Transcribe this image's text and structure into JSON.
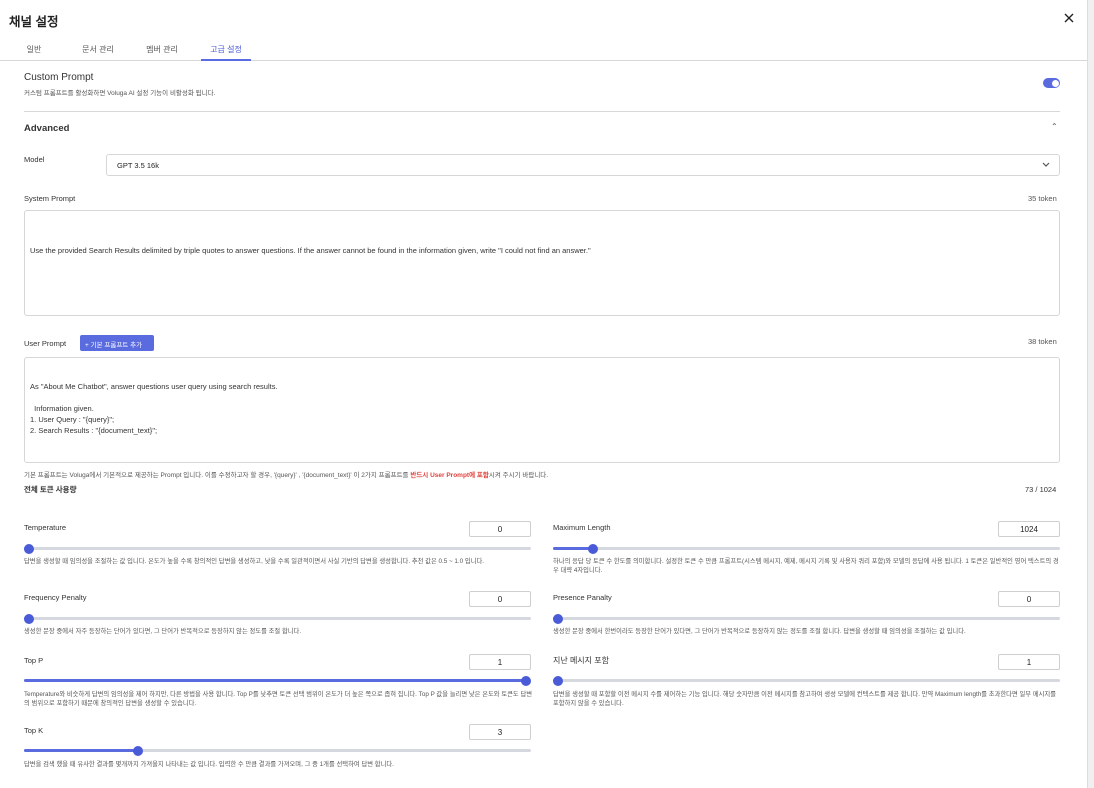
{
  "dialog": {
    "title": "채널 설정"
  },
  "tabs": [
    {
      "label": "일반"
    },
    {
      "label": "문서 관리"
    },
    {
      "label": "멤버 관리"
    },
    {
      "label": "고급 설정"
    }
  ],
  "custom_prompt": {
    "title": "Custom Prompt",
    "description": "커스텀 프롬프트를 활성화하면 Voluga AI 설정 기능이 비활성화 됩니다.",
    "enabled": true
  },
  "advanced": {
    "title": "Advanced",
    "model_label": "Model",
    "model_value": "GPT 3.5 16k",
    "system_prompt": {
      "label": "System Prompt",
      "token_count": "35 token",
      "text": "Use the provided Search Results delimited by triple quotes to answer questions. If the answer cannot be found in the information given, write \"I could not find an answer.\""
    },
    "user_prompt": {
      "label": "User Prompt",
      "add_button": "+ 기본 프롬프트 추가",
      "token_count": "38 token",
      "text": "\nAs \"About Me Chatbot\", answer questions user query using search results.\n\n  Information given.\n1. User Query : \"{query}\";\n2. Search Results : \"{document_text}\";"
    },
    "notice_prefix": "기본 프롬프트는 Voluga에서 기본적으로 제공하는 Prompt 입니다. 이를 수정하고자 할 경우, '{query}' , '{document_text}' 이 2가지 프롬프트를 ",
    "notice_emphasis": "반드시 User Prompt에 포함",
    "notice_suffix": "시켜 주시기 바랍니다.",
    "total_label": "전체 토큰 사용량",
    "total_value": "73 / 1024"
  },
  "params": {
    "temperature": {
      "label": "Temperature",
      "value": "0",
      "level": 0.0,
      "desc": "답변을 생성할 때 임의성을 조절하는 값 입니다. 온도가 높을 수록 창의적인 답변을 생성하고, 낮을 수록 일관적이면서 사실 기반의 답변을 생성합니다. 추천 값은 0.5 ~ 1.0 입니다."
    },
    "max_length": {
      "label": "Maximum Length",
      "value": "1024",
      "level": 0.07,
      "desc": "하나의 응답 당 토큰 수 한도를 의미합니다. 설정한 토큰 수 만큼 프롬프트(시스템 메시지, 예제, 메시지 기록 및 사용자 쿼리 포함)와 모델의 응답에 사용 됩니다. 1 토큰은 일반적인 영어 텍스트의 경우 대략 4자입니다."
    },
    "frequency_penalty": {
      "label": "Frequency Penalty",
      "value": "0",
      "level": 0.0,
      "desc": "생성한 문장 중에서 자주 등장하는 단어가 있다면, 그 단어가 반복적으로 등장하지 않는 정도를 조절 합니다."
    },
    "presence_penalty": {
      "label": "Presence Panalty",
      "value": "0",
      "level": 0.0,
      "desc": "생성한 문장 중에서 한번이라도 등장한 단어가 있다면, 그 단어가 반복적으로 등장하지 않는 정도를 조절 합니다. 답변을 생성할 때 임의성을 조절하는 값 입니다."
    },
    "top_p": {
      "label": "Top P",
      "value": "1",
      "level": 1.0,
      "desc": "Temperature와 비슷하게 답변의 임의성을 제어 하지만, 다른 방법을 사용 합니다. Top P를 낮추면 토큰 선택 범위이 온도가 더 높은 쪽으로 좁혀 집니다. Top P 값을 늘리면 낮은 온도와 토큰도 답변의 범위으로 포함하기 때문에 창의적인 답변을 생성할 수 있습니다."
    },
    "past_messages": {
      "label": "지난 메시지 포함",
      "value": "1",
      "level": 0.0,
      "desc": "답변을 생성할 때 포함할 이전 메시지 수를 제어하는 기능 입니다. 해당 숫자만큼 이전 메시지를 참고하여 생성 모델에 컨텍스트를 제공 합니다. 만약 Maximum length를 초과한다면 일부 메시지를 포함하지 않을 수 있습니다."
    },
    "top_k": {
      "label": "Top K",
      "value": "3",
      "level": 0.22,
      "desc": "답변을 검색 했을 때 유사한 결과를 몇개까지 가져올지 나타내는 값 입니다. 입력한 수 만큼 결과를 가져오며, 그 중 1개를 선택하여 답변 합니다."
    }
  }
}
